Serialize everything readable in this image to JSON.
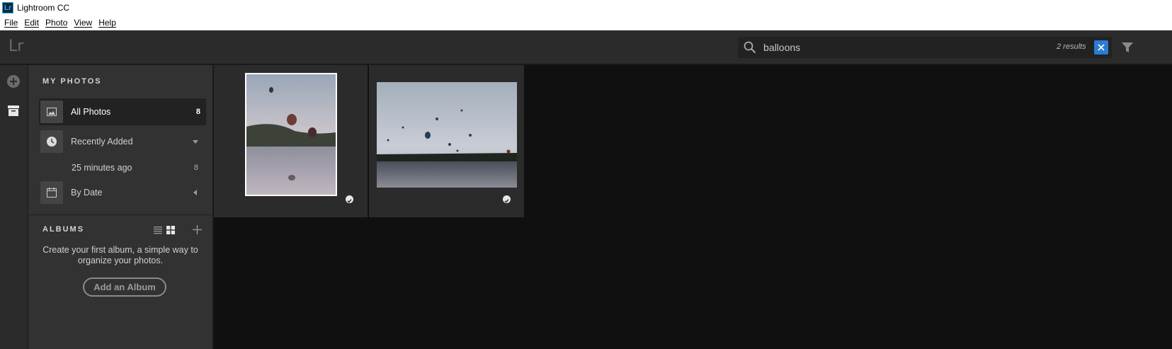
{
  "window": {
    "title": "Lightroom CC",
    "app_icon_text": "Lr"
  },
  "menu": {
    "items": [
      "File",
      "Edit",
      "Photo",
      "View",
      "Help"
    ]
  },
  "topbar": {
    "logo": "Lr"
  },
  "search": {
    "value": "balloons",
    "results": "2 results"
  },
  "sidebar": {
    "my_photos_heading": "MY PHOTOS",
    "all_photos": {
      "label": "All Photos",
      "count": "8"
    },
    "recently_added": {
      "label": "Recently Added"
    },
    "recent_sub": {
      "label": "25 minutes ago",
      "count": "8"
    },
    "by_date": {
      "label": "By Date"
    },
    "albums_heading": "ALBUMS",
    "albums_empty_text": "Create your first album, a simple way to organize your photos.",
    "add_album_label": "Add an Album"
  },
  "colors": {
    "accent": "#2b7cd3",
    "panel": "#323232",
    "grid_bg": "#101010"
  }
}
